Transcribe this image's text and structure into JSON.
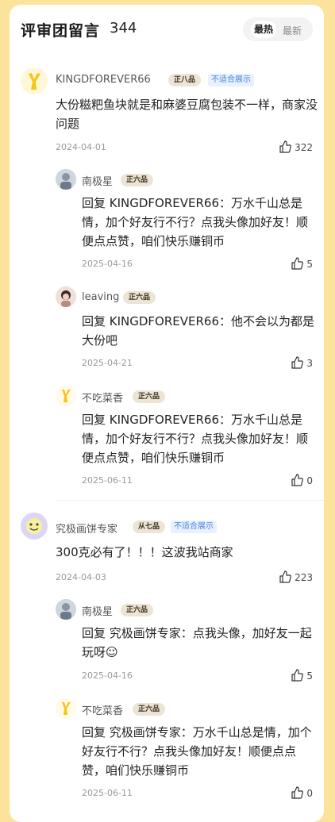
{
  "header": {
    "title": "评审团留言",
    "count": "344",
    "sort_hot": "最热",
    "sort_new": "最新"
  },
  "comments": [
    {
      "user": "KINGDFOREVER66",
      "badge": "正八品",
      "tag": "不适合展示",
      "text": "大份糍粑鱼块就是和麻婆豆腐包装不一样，商家没问题",
      "date": "2024-04-01",
      "likes": "322",
      "replies": [
        {
          "user": "南极星",
          "badge": "正六品",
          "text": "回复 KINGDFOREVER66：万水千山总是情，加个好友行不行？点我头像加好友！顺便点点赞，咱们快乐赚铜币",
          "date": "2025-04-16",
          "likes": "5"
        },
        {
          "user": "leaving",
          "badge": "正六品",
          "text": "回复 KINGDFOREVER66：他不会以为都是大份吧",
          "date": "2025-04-21",
          "likes": "3"
        },
        {
          "user": "不吃菜香",
          "badge": "正六品",
          "text": "回复 KINGDFOREVER66：万水千山总是情，加个好友行不行？点我头像加好友！顺便点点赞，咱们快乐赚铜币",
          "date": "2025-06-11",
          "likes": "0"
        }
      ]
    },
    {
      "user": "究极画饼专家",
      "badge": "从七品",
      "tag": "不适合展示",
      "text": "300克必有了！！！这波我站商家",
      "date": "2024-04-03",
      "likes": "223",
      "replies": [
        {
          "user": "南极星",
          "badge": "正六品",
          "text": "回复 究极画饼专家：点我头像，加好友一起玩呀☺",
          "date": "2025-04-16",
          "likes": "5"
        },
        {
          "user": "不吃菜香",
          "badge": "正六品",
          "text": "回复 究极画饼专家：万水千山总是情，加个好友行不行？点我头像加好友！顺便点点赞，咱们快乐赚铜币",
          "date": "2025-06-11",
          "likes": "0"
        }
      ]
    }
  ]
}
